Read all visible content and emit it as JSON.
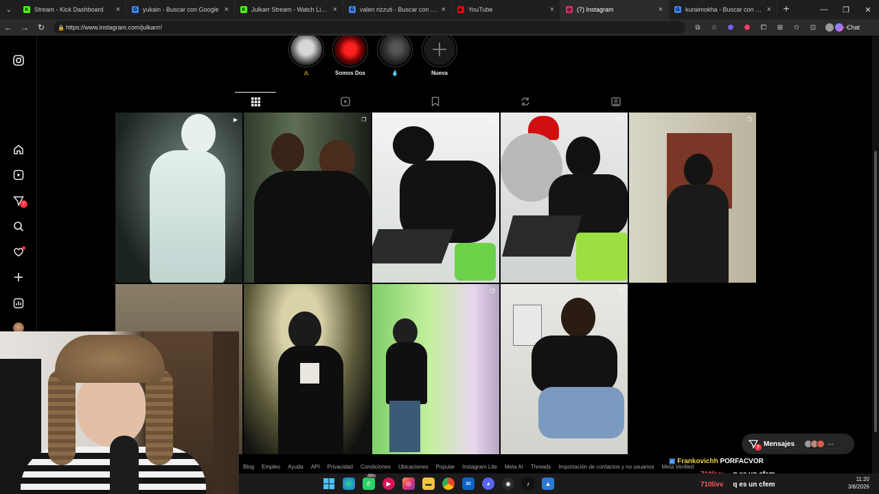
{
  "browser": {
    "tabs": [
      {
        "title": "Stream - Kick Dashboard",
        "fav_color": "#53fc18",
        "fav_char": "K"
      },
      {
        "title": "yukain - Buscar con Google",
        "fav_color": "#4285f4",
        "fav_char": "G"
      },
      {
        "title": "Julkarr Stream - Watch Live on Ki",
        "fav_color": "#53fc18",
        "fav_char": "K"
      },
      {
        "title": "valen rizzuti - Buscar con Google",
        "fav_color": "#4285f4",
        "fav_char": "G"
      },
      {
        "title": "YouTube",
        "fav_color": "#ff0000",
        "fav_char": "▶"
      },
      {
        "title": "(7) Instagram",
        "fav_color": "#e1306c",
        "fav_char": "◎",
        "active": true
      },
      {
        "title": "kuraimokha - Buscar con Google",
        "fav_color": "#4285f4",
        "fav_char": "G"
      }
    ],
    "url": "https://www.instagram.com/julkarrr/",
    "chat_label": "Chat"
  },
  "sidebar": {
    "messages_badge": "7"
  },
  "highlights": [
    {
      "label": "⚠",
      "color": "#d6a21a"
    },
    {
      "label": "Somos Dos",
      "color": "#f2f2f2"
    },
    {
      "label": "💧",
      "color": "#4aa3ff"
    },
    {
      "label": "Nueva",
      "color": "#f2f2f2"
    }
  ],
  "footer_links": [
    "Blog",
    "Empleo",
    "Ayuda",
    "API",
    "Privacidad",
    "Condiciones",
    "Ubicaciones",
    "Popular",
    "Instagram Lite",
    "Meta AI",
    "Threads",
    "Importación de contactos y no usuarios",
    "Meta Verified"
  ],
  "messages_button": {
    "label": "Mensajes",
    "badge": "7"
  },
  "stream_chat": {
    "highlight_user": "Frankovichh",
    "highlight_msg": "PORFACVOR",
    "lines": [
      {
        "user": "710livv",
        "msg": "q es un cfem"
      },
      {
        "user": "710livv",
        "msg": "q es un cfem"
      }
    ]
  },
  "clock": {
    "time": "11:20",
    "date": "3/8/2026"
  },
  "taskbar_badge": "99+"
}
